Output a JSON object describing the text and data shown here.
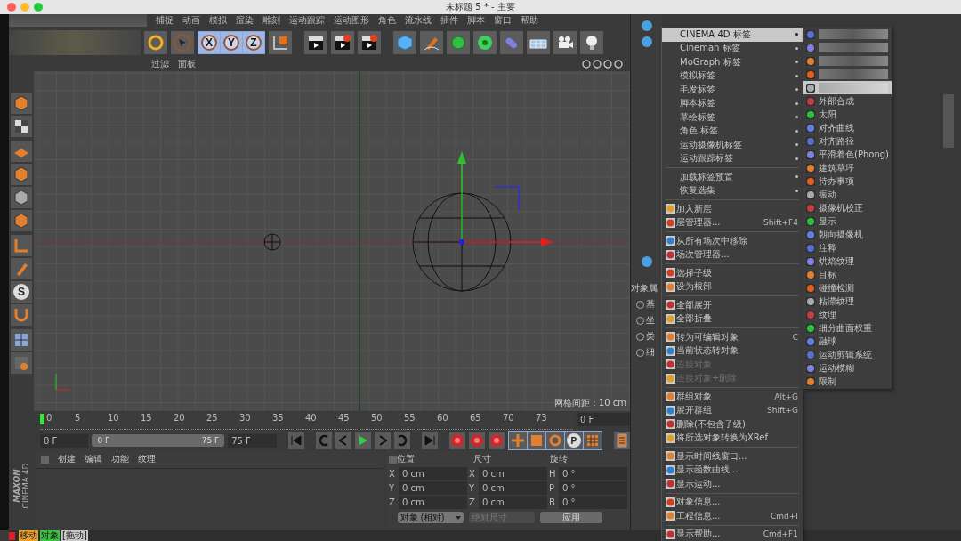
{
  "window": {
    "title": "未标题 5 * - 主要"
  },
  "menubar": [
    "捕捉",
    "动画",
    "模拟",
    "渲染",
    "雕刻",
    "运动跟踪",
    "运动图形",
    "角色",
    "流水线",
    "插件",
    "脚本",
    "窗口",
    "帮助"
  ],
  "toolbar": {
    "axis_buttons": [
      "X",
      "Y",
      "Z"
    ]
  },
  "viewport": {
    "menu": [
      "过滤",
      "面板"
    ],
    "grid_label": "网格间距 : 10 cm"
  },
  "left_tools": {
    "snap_label": "S"
  },
  "timeline": {
    "ticks": [
      "0",
      "5",
      "10",
      "15",
      "20",
      "25",
      "30",
      "35",
      "40",
      "45",
      "50",
      "55",
      "60",
      "65",
      "70",
      "73"
    ],
    "current_frame": "0 F",
    "range_slider": {
      "level": 1
    },
    "start": "0 F",
    "range_start": "0 F",
    "range_end": "75 F",
    "end": "75 F",
    "key_label": "P"
  },
  "materials": {
    "menu": [
      "创建",
      "编辑",
      "功能",
      "纹理"
    ]
  },
  "coordinates": {
    "headers": [
      "位置",
      "尺寸",
      "旋转"
    ],
    "rows": [
      {
        "axis": "X",
        "position": "0 cm",
        "size_axis": "X",
        "size": "0 cm",
        "rot_axis": "H",
        "rotation": "0 °"
      },
      {
        "axis": "Y",
        "position": "0 cm",
        "size_axis": "Y",
        "size": "0 cm",
        "rot_axis": "P",
        "rotation": "0 °"
      },
      {
        "axis": "Z",
        "position": "0 cm",
        "size_axis": "Z",
        "size": "0 cm",
        "rot_axis": "B",
        "rotation": "0 °"
      }
    ],
    "mode": "对象 (相对)",
    "size_mode": "绝对尺寸",
    "apply": "应用"
  },
  "logo": {
    "brand": "MAXON",
    "product": "CINEMA 4D"
  },
  "status_bar": {
    "parts": [
      {
        "text": "移动",
        "color": "#e8a030"
      },
      {
        "text": "对象",
        "color": "#3cc040"
      },
      {
        "text": "[拖动]",
        "color": "#c8c8c8"
      }
    ]
  },
  "attributes": {
    "label": "对象属",
    "radios": [
      {
        "label": "基",
        "selected": false
      },
      {
        "label": "坐",
        "selected": false
      },
      {
        "label": "类",
        "selected": false
      },
      {
        "label": "细",
        "selected": false
      }
    ]
  },
  "context_menu": {
    "items": [
      {
        "kind": "item",
        "label": "CINEMA 4D 标签",
        "submenu": true,
        "selected": true
      },
      {
        "kind": "item",
        "label": "Cineman 标签",
        "submenu": true,
        "selected": false
      },
      {
        "kind": "item",
        "label": "MoGraph 标签",
        "submenu": true,
        "selected": false
      },
      {
        "kind": "item",
        "label": "模拟标签",
        "submenu": true,
        "selected": false
      },
      {
        "kind": "item",
        "label": "毛发标签",
        "submenu": true,
        "selected": false
      },
      {
        "kind": "item",
        "label": "脚本标签",
        "submenu": true,
        "selected": false
      },
      {
        "kind": "item",
        "label": "草绘标签",
        "submenu": true,
        "selected": false
      },
      {
        "kind": "item",
        "label": "角色 标签",
        "submenu": true,
        "selected": false
      },
      {
        "kind": "item",
        "label": "运动摄像机标签",
        "submenu": true,
        "selected": false
      },
      {
        "kind": "item",
        "label": "运动跟踪标签",
        "submenu": true,
        "selected": false
      },
      {
        "kind": "separator"
      },
      {
        "kind": "item",
        "label": "加载标签预置",
        "submenu": true,
        "selected": false
      },
      {
        "kind": "item",
        "label": "恢复选集",
        "submenu": true,
        "selected": false
      },
      {
        "kind": "separator"
      },
      {
        "kind": "item",
        "label": "加入新层",
        "icon": true,
        "selected": false
      },
      {
        "kind": "item",
        "label": "层管理器...",
        "shortcut": "Shift+F4",
        "icon": true,
        "selected": false
      },
      {
        "kind": "separator"
      },
      {
        "kind": "item",
        "label": "从所有场次中移除",
        "icon": true,
        "selected": false
      },
      {
        "kind": "item",
        "label": "场次管理器...",
        "icon": true,
        "selected": false
      },
      {
        "kind": "separator"
      },
      {
        "kind": "item",
        "label": "选择子级",
        "icon": true,
        "selected": false
      },
      {
        "kind": "item",
        "label": "设为根部",
        "icon": true,
        "selected": false
      },
      {
        "kind": "separator"
      },
      {
        "kind": "item",
        "label": "全部展开",
        "icon": true,
        "selected": false
      },
      {
        "kind": "item",
        "label": "全部折叠",
        "icon": true,
        "selected": false
      },
      {
        "kind": "separator"
      },
      {
        "kind": "item",
        "label": "转为可编辑对象",
        "shortcut": "C",
        "icon": true,
        "selected": false
      },
      {
        "kind": "item",
        "label": "当前状态转对象",
        "icon": true,
        "selected": false
      },
      {
        "kind": "item",
        "label": "连接对象",
        "icon": true,
        "disabled": true,
        "selected": false
      },
      {
        "kind": "item",
        "label": "连接对象+删除",
        "icon": true,
        "disabled": true,
        "selected": false
      },
      {
        "kind": "separator"
      },
      {
        "kind": "item",
        "label": "群组对象",
        "shortcut": "Alt+G",
        "icon": true,
        "selected": false
      },
      {
        "kind": "item",
        "label": "展开群组",
        "shortcut": "Shift+G",
        "icon": true,
        "selected": false
      },
      {
        "kind": "item",
        "label": "删除(不包含子级)",
        "icon": true,
        "selected": false
      },
      {
        "kind": "item",
        "label": "将所选对象转换为XRef",
        "icon": true,
        "selected": false
      },
      {
        "kind": "separator"
      },
      {
        "kind": "item",
        "label": "显示时间线窗口...",
        "icon": true,
        "selected": false
      },
      {
        "kind": "item",
        "label": "显示函数曲线...",
        "icon": true,
        "selected": false
      },
      {
        "kind": "item",
        "label": "显示运动...",
        "icon": true,
        "selected": false
      },
      {
        "kind": "separator"
      },
      {
        "kind": "item",
        "label": "对象信息...",
        "icon": true,
        "selected": false
      },
      {
        "kind": "item",
        "label": "工程信息...",
        "shortcut": "Cmd+I",
        "icon": true,
        "selected": false
      },
      {
        "kind": "separator"
      },
      {
        "kind": "item",
        "label": "显示帮助...",
        "shortcut": "Cmd+F1",
        "icon": true,
        "selected": false
      }
    ]
  },
  "submenu": {
    "items": [
      {
        "kind": "obscured",
        "selected": false
      },
      {
        "kind": "obscured",
        "selected": false
      },
      {
        "kind": "obscured",
        "selected": false
      },
      {
        "kind": "obscured",
        "selected": false
      },
      {
        "kind": "obscured",
        "selected": true
      },
      {
        "kind": "item",
        "label": "外部合成",
        "selected": false
      },
      {
        "kind": "item",
        "label": "太阳",
        "selected": false
      },
      {
        "kind": "item",
        "label": "对齐曲线",
        "selected": false
      },
      {
        "kind": "item",
        "label": "对齐路径",
        "selected": false
      },
      {
        "kind": "item",
        "label": "平滑着色(Phong)",
        "selected": false
      },
      {
        "kind": "item",
        "label": "建筑草坪",
        "selected": false
      },
      {
        "kind": "item",
        "label": "待办事项",
        "selected": false
      },
      {
        "kind": "item",
        "label": "振动",
        "selected": false
      },
      {
        "kind": "item",
        "label": "摄像机校正",
        "selected": false
      },
      {
        "kind": "item",
        "label": "显示",
        "selected": false
      },
      {
        "kind": "item",
        "label": "朝向摄像机",
        "selected": false
      },
      {
        "kind": "item",
        "label": "注释",
        "selected": false
      },
      {
        "kind": "item",
        "label": "烘焙纹理",
        "selected": false
      },
      {
        "kind": "item",
        "label": "目标",
        "selected": false
      },
      {
        "kind": "item",
        "label": "碰撞检测",
        "selected": false
      },
      {
        "kind": "item",
        "label": "粘滞纹理",
        "selected": false
      },
      {
        "kind": "item",
        "label": "纹理",
        "selected": false
      },
      {
        "kind": "item",
        "label": "细分曲面权重",
        "selected": false
      },
      {
        "kind": "item",
        "label": "融球",
        "selected": false
      },
      {
        "kind": "item",
        "label": "运动剪辑系统",
        "selected": false
      },
      {
        "kind": "item",
        "label": "运动模糊",
        "selected": false
      },
      {
        "kind": "item",
        "label": "限制",
        "selected": false
      }
    ]
  }
}
